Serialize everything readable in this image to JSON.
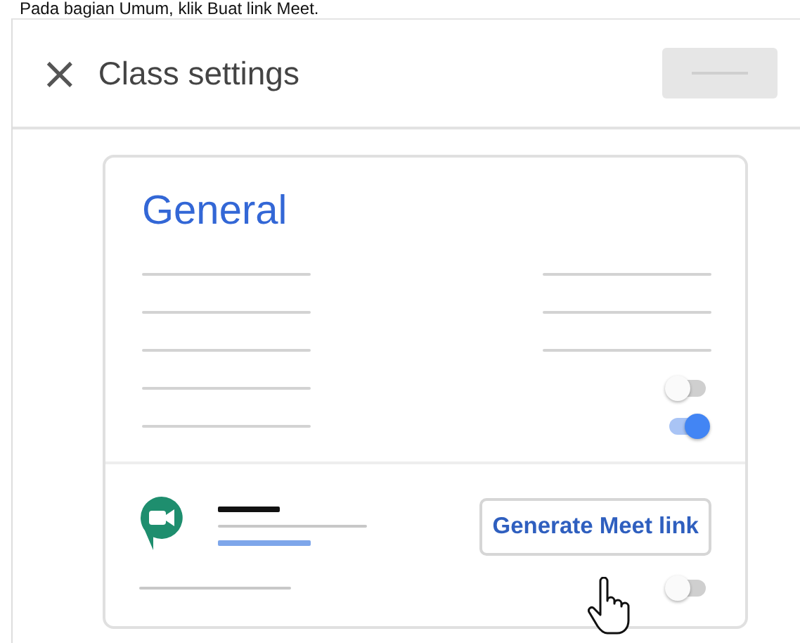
{
  "caption": "Pada bagian Umum, klik Buat link Meet.",
  "dialog": {
    "close": "×",
    "title": "Class settings"
  },
  "card": {
    "title": "General",
    "toggles": [
      {
        "on": false
      },
      {
        "on": true
      }
    ],
    "meet": {
      "button": "Generate Meet link",
      "toggle": {
        "on": false
      }
    }
  }
}
